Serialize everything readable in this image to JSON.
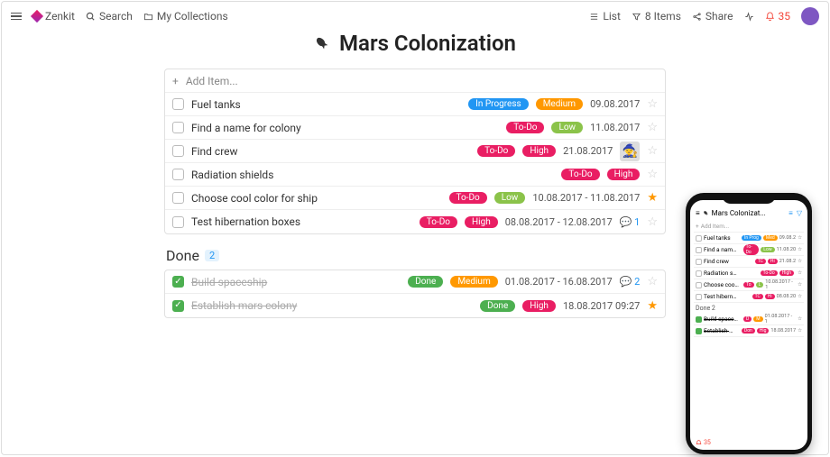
{
  "app_name": "Zenkit",
  "topbar": {
    "search": "Search",
    "collections": "My Collections",
    "list": "List",
    "filter": "8 Items",
    "share": "Share",
    "notifications": "35"
  },
  "page_title": "Mars Colonization",
  "add_item": "Add Item...",
  "colors": {
    "in_progress": "#2196f3",
    "todo": "#e91e63",
    "done": "#4caf50",
    "medium": "#ff9800",
    "low": "#8bc34a",
    "high": "#e91e63"
  },
  "items": [
    {
      "title": "Fuel tanks",
      "status": "In Progress",
      "priority": "Medium",
      "date": "09.08.2017",
      "starred": false
    },
    {
      "title": "Find a name for colony",
      "status": "To-Do",
      "priority": "Low",
      "date": "11.08.2017",
      "starred": false
    },
    {
      "title": "Find crew",
      "status": "To-Do",
      "priority": "High",
      "date": "21.08.2017",
      "starred": false,
      "avatar": true
    },
    {
      "title": "Radiation shields",
      "status": "To-Do",
      "priority": "High",
      "date": "",
      "starred": false
    },
    {
      "title": "Choose cool color for ship",
      "status": "To-Do",
      "priority": "Low",
      "date": "10.08.2017 - 11.08.2017",
      "starred": true
    },
    {
      "title": "Test hibernation boxes",
      "status": "To-Do",
      "priority": "High",
      "date": "08.08.2017 - 12.08.2017",
      "starred": false,
      "comments": "1"
    }
  ],
  "done_section": {
    "label": "Done",
    "count": "2"
  },
  "done_items": [
    {
      "title": "Build spaceship",
      "status": "Done",
      "priority": "Medium",
      "date": "01.08.2017 - 16.08.2017",
      "starred": false,
      "comments": "2"
    },
    {
      "title": "Establish mars colony",
      "status": "Done",
      "priority": "High",
      "date": "18.08.2017 09:27",
      "starred": true
    }
  ],
  "mobile": {
    "title": "Mars Colonizat...",
    "add": "Add Item...",
    "rows": [
      {
        "t": "Fuel tanks",
        "s": "In Prog",
        "p": "Med",
        "d": "09.08.2"
      },
      {
        "t": "Find a name f...",
        "s": "To-Do",
        "p": "Low",
        "d": "11.08.20"
      },
      {
        "t": "Find crew",
        "s": "TC",
        "p": "Hi",
        "d": "21.08.2"
      },
      {
        "t": "Radiation shields",
        "s": "To-Do",
        "p": "High",
        "d": ""
      },
      {
        "t": "Choose cool c...",
        "s": "To",
        "p": "L",
        "d": "10.08.2017 - 1"
      },
      {
        "t": "Test hibernati...",
        "s": "TC",
        "p": "Hi",
        "d": "08.08.20"
      }
    ],
    "done_label": "Done",
    "done_count": "2",
    "done_rows": [
      {
        "t": "Build spaceship",
        "s": "D",
        "p": "M",
        "d": "01.08.2017 - 1"
      },
      {
        "t": "Establish mars...",
        "s": "Don",
        "p": "Hig",
        "d": "18.08.2017"
      }
    ],
    "notif": "35"
  }
}
